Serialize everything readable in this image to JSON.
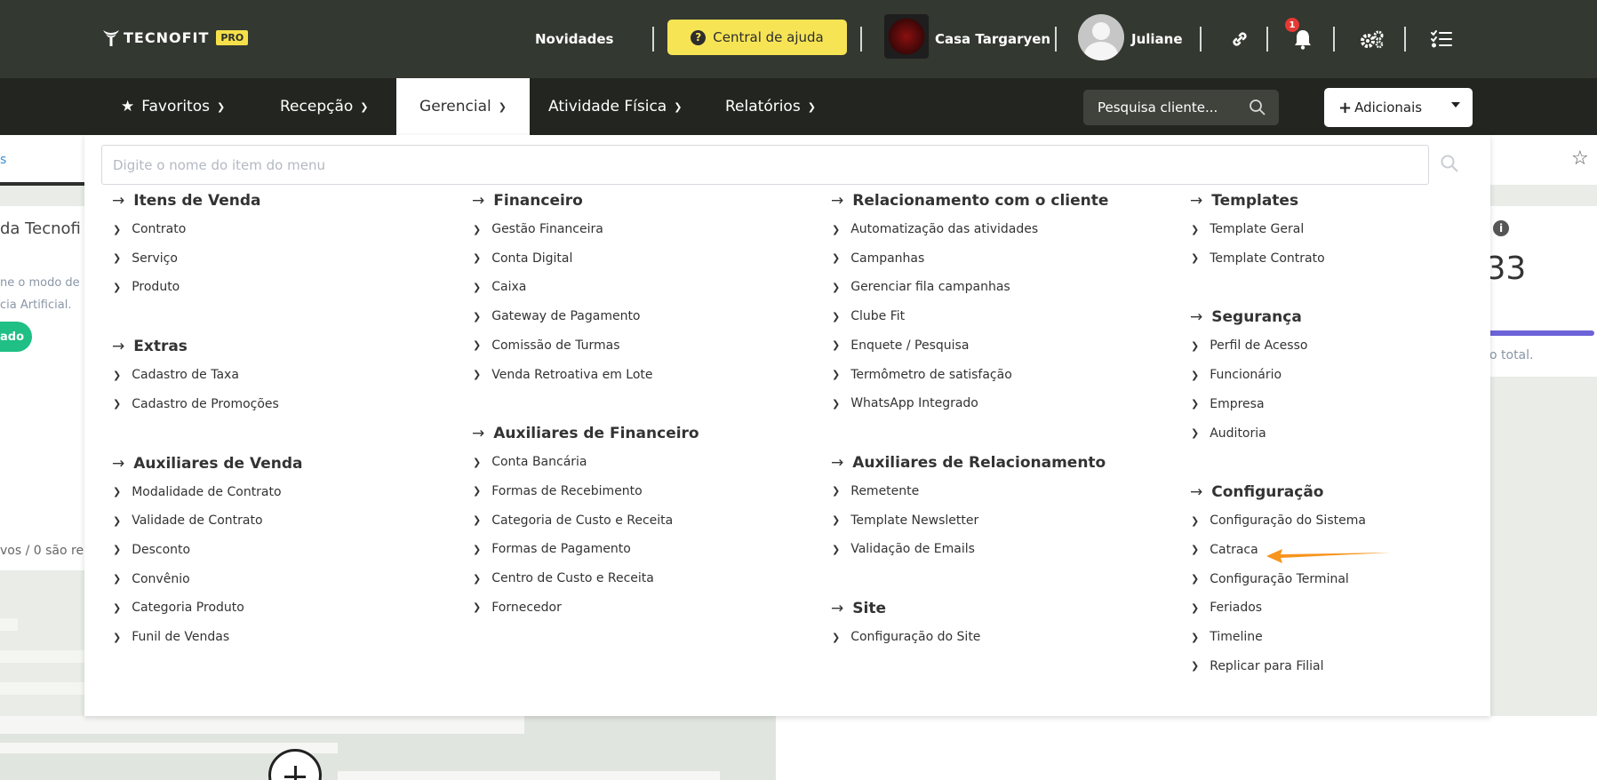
{
  "brand": {
    "name": "TECNOFIT",
    "badge": "PRO"
  },
  "topbar": {
    "news_label": "Novidades",
    "help_label": "Central de ajuda",
    "company_name": "Casa Targaryen",
    "user_name": "Juliane",
    "notification_count": "1"
  },
  "nav": {
    "items": [
      {
        "label": "Favoritos"
      },
      {
        "label": "Recepção"
      },
      {
        "label": "Gerencial"
      },
      {
        "label": "Atividade Física"
      },
      {
        "label": "Relatórios"
      }
    ],
    "search_label": "Pesquisa cliente...",
    "add_label": "Adicionais"
  },
  "background": {
    "tab_text": "s",
    "card_title": "da Tecnofi",
    "card_line1": "ne o modo de",
    "card_line2": "cia Artificial.",
    "pill_text": "ado",
    "summary_text": "vos / 0 são re",
    "value_text": ",33",
    "total_text": "o total."
  },
  "menu": {
    "search_placeholder": "Digite o nome do item do menu",
    "columns": [
      {
        "sections": [
          {
            "title": "Itens de Venda",
            "items": [
              "Contrato",
              "Serviço",
              "Produto"
            ]
          },
          {
            "title": "Extras",
            "items": [
              "Cadastro de Taxa",
              "Cadastro de Promoções"
            ]
          },
          {
            "title": "Auxiliares de Venda",
            "items": [
              "Modalidade de Contrato",
              "Validade de Contrato",
              "Desconto",
              "Convênio",
              "Categoria Produto",
              "Funil de Vendas"
            ]
          }
        ]
      },
      {
        "sections": [
          {
            "title": "Financeiro",
            "items": [
              "Gestão Financeira",
              "Conta Digital",
              "Caixa",
              "Gateway de Pagamento",
              "Comissão de Turmas",
              "Venda Retroativa em Lote"
            ]
          },
          {
            "title": "Auxiliares de Financeiro",
            "items": [
              "Conta Bancária",
              "Formas de Recebimento",
              "Categoria de Custo e Receita",
              "Formas de Pagamento",
              "Centro de Custo e Receita",
              "Fornecedor"
            ]
          }
        ]
      },
      {
        "sections": [
          {
            "title": "Relacionamento com o cliente",
            "items": [
              "Automatização das atividades",
              "Campanhas",
              "Gerenciar fila campanhas",
              "Clube Fit",
              "Enquete / Pesquisa",
              "Termômetro de satisfação",
              "WhatsApp Integrado"
            ]
          },
          {
            "title": "Auxiliares de Relacionamento",
            "items": [
              "Remetente",
              "Template Newsletter",
              "Validação de Emails"
            ]
          },
          {
            "title": "Site",
            "items": [
              "Configuração do Site"
            ]
          }
        ]
      },
      {
        "sections": [
          {
            "title": "Templates",
            "items": [
              "Template Geral",
              "Template Contrato"
            ]
          },
          {
            "title": "Segurança",
            "items": [
              "Perfil de Acesso",
              "Funcionário",
              "Empresa",
              "Auditoria"
            ]
          },
          {
            "title": "Configuração",
            "items": [
              "Configuração do Sistema",
              "Catraca",
              "Configuração Terminal",
              "Feriados",
              "Timeline",
              "Replicar para Filial"
            ]
          }
        ]
      }
    ]
  },
  "colors": {
    "topbar": "#333830",
    "navbar": "#232620",
    "help_button": "#f6e455",
    "pointer": "#f7941d"
  }
}
